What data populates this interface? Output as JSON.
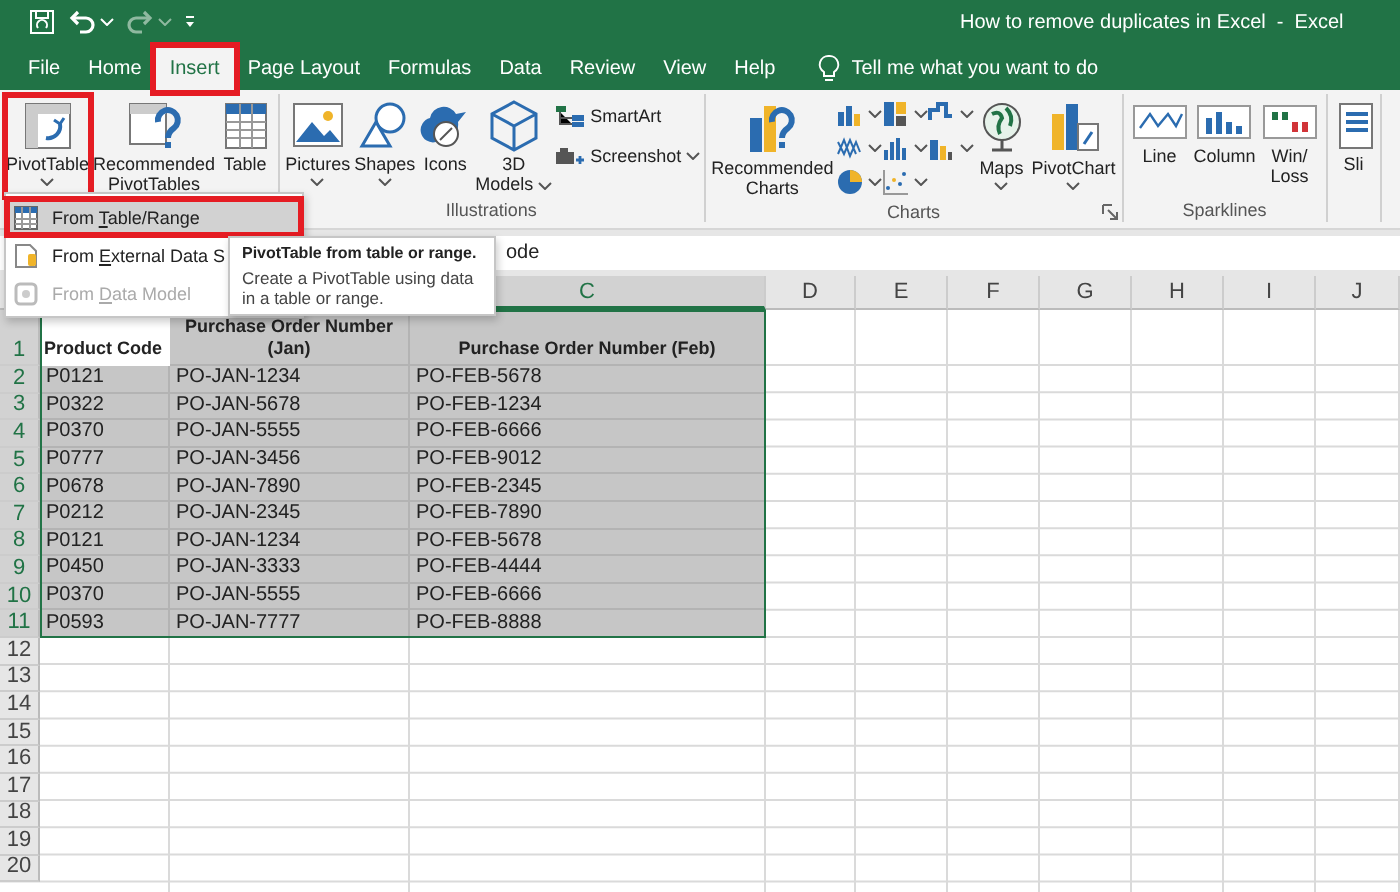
{
  "window": {
    "title": "How to remove duplicates in Excel  -  Excel"
  },
  "tabs": [
    {
      "label": "File",
      "selected": false,
      "annotated": false
    },
    {
      "label": "Home",
      "selected": false,
      "annotated": false
    },
    {
      "label": "Insert",
      "selected": true,
      "annotated": true
    },
    {
      "label": "Page Layout",
      "selected": false,
      "annotated": false
    },
    {
      "label": "Formulas",
      "selected": false,
      "annotated": false
    },
    {
      "label": "Data",
      "selected": false,
      "annotated": false
    },
    {
      "label": "Review",
      "selected": false,
      "annotated": false
    },
    {
      "label": "View",
      "selected": false,
      "annotated": false
    },
    {
      "label": "Help",
      "selected": false,
      "annotated": false
    }
  ],
  "tell_me": {
    "placeholder": "Tell me what you want to do"
  },
  "ribbon": [
    {
      "items": [
        {
          "kind": "large",
          "label": "PivotTable",
          "dropdown": true,
          "annotated": true
        },
        {
          "kind": "large",
          "label": "Recommended\nPivotTables",
          "dropdown": false,
          "annotated": false
        },
        {
          "kind": "large",
          "label": "Table",
          "dropdown": false,
          "annotated": false
        }
      ]
    },
    {
      "label": "Illustrations",
      "items": [
        {
          "kind": "large",
          "label": "Pictures",
          "dropdown": true,
          "annotated": false
        },
        {
          "kind": "large",
          "label": "Shapes",
          "dropdown": true,
          "annotated": false
        },
        {
          "kind": "large",
          "label": "Icons",
          "dropdown": false,
          "annotated": false
        },
        {
          "kind": "large",
          "label": "3D\nModels",
          "dropdown": true,
          "annotated": false
        },
        {
          "kind": "small",
          "label": "SmartArt",
          "dropdown": false,
          "annotated": false
        },
        {
          "kind": "small",
          "label": "Screenshot",
          "dropdown": true,
          "annotated": false
        }
      ]
    },
    {
      "label": "Charts",
      "launcher": true,
      "items": [
        {
          "kind": "large",
          "label": "Recommended\nCharts",
          "dropdown": false,
          "annotated": false
        },
        {
          "kind": "gallery",
          "annotated": false
        },
        {
          "kind": "large",
          "label": "Maps",
          "dropdown": true,
          "annotated": false
        },
        {
          "kind": "large",
          "label": "PivotChart",
          "dropdown": true,
          "annotated": false
        }
      ]
    },
    {
      "label": "Sparklines",
      "items": [
        {
          "kind": "large",
          "label": "Line",
          "dropdown": false,
          "annotated": false
        },
        {
          "kind": "large",
          "label": "Column",
          "dropdown": false,
          "annotated": false
        },
        {
          "kind": "large",
          "label": "Win/\nLoss",
          "dropdown": false,
          "annotated": false
        }
      ]
    },
    {
      "items": [
        {
          "kind": "large",
          "label": "Sli",
          "dropdown": false,
          "annotated": false
        }
      ]
    }
  ],
  "formula_bar": {
    "value": "ode"
  },
  "dropdown_menu": [
    {
      "before": "From ",
      "key": "T",
      "after": "able/Range",
      "selected": true,
      "disabled": false,
      "annotated": true
    },
    {
      "before": "From ",
      "key": "E",
      "after": "xternal Data S",
      "selected": false,
      "disabled": false,
      "annotated": false
    },
    {
      "before": "From ",
      "key": "D",
      "after": "ata Model",
      "selected": false,
      "disabled": true,
      "annotated": false
    }
  ],
  "tooltip": {
    "title": "PivotTable from table or range.",
    "body": "Create a PivotTable using data in a table or range."
  },
  "sheet": {
    "column_headers": [
      "C",
      "D",
      "E",
      "F",
      "G",
      "H",
      "I",
      "J"
    ],
    "rows": [
      {
        "number": "1",
        "kind": "header",
        "selected": true,
        "active": true,
        "cells": [
          "Product Code",
          "Purchase Order Number (Jan)",
          "Purchase Order Number (Feb)"
        ]
      },
      {
        "number": "2",
        "kind": "data",
        "selected": true,
        "active": false,
        "cells": [
          "P0121",
          "PO-JAN-1234",
          "PO-FEB-5678"
        ]
      },
      {
        "number": "3",
        "kind": "data",
        "selected": true,
        "active": false,
        "cells": [
          "P0322",
          "PO-JAN-5678",
          "PO-FEB-1234"
        ]
      },
      {
        "number": "4",
        "kind": "data",
        "selected": true,
        "active": false,
        "cells": [
          "P0370",
          "PO-JAN-5555",
          "PO-FEB-6666"
        ]
      },
      {
        "number": "5",
        "kind": "data",
        "selected": true,
        "active": false,
        "cells": [
          "P0777",
          "PO-JAN-3456",
          "PO-FEB-9012"
        ]
      },
      {
        "number": "6",
        "kind": "data",
        "selected": true,
        "active": false,
        "cells": [
          "P0678",
          "PO-JAN-7890",
          "PO-FEB-2345"
        ]
      },
      {
        "number": "7",
        "kind": "data",
        "selected": true,
        "active": false,
        "cells": [
          "P0212",
          "PO-JAN-2345",
          "PO-FEB-7890"
        ]
      },
      {
        "number": "8",
        "kind": "data",
        "selected": true,
        "active": false,
        "cells": [
          "P0121",
          "PO-JAN-1234",
          "PO-FEB-5678"
        ]
      },
      {
        "number": "9",
        "kind": "data",
        "selected": true,
        "active": false,
        "cells": [
          "P0450",
          "PO-JAN-3333",
          "PO-FEB-4444"
        ]
      },
      {
        "number": "10",
        "kind": "data",
        "selected": true,
        "active": false,
        "cells": [
          "P0370",
          "PO-JAN-5555",
          "PO-FEB-6666"
        ]
      },
      {
        "number": "11",
        "kind": "data",
        "selected": true,
        "active": false,
        "cells": [
          "P0593",
          "PO-JAN-7777",
          "PO-FEB-8888"
        ]
      },
      {
        "number": "12",
        "kind": "data",
        "selected": false,
        "cells": []
      },
      {
        "number": "13",
        "kind": "data",
        "selected": false,
        "cells": []
      },
      {
        "number": "14",
        "kind": "data",
        "selected": false,
        "cells": []
      },
      {
        "number": "15",
        "kind": "data",
        "selected": false,
        "cells": []
      },
      {
        "number": "16",
        "kind": "data",
        "selected": false,
        "cells": []
      },
      {
        "number": "17",
        "kind": "data",
        "selected": false,
        "cells": []
      },
      {
        "number": "18",
        "kind": "data",
        "selected": false,
        "cells": []
      },
      {
        "number": "19",
        "kind": "data",
        "selected": false,
        "cells": []
      },
      {
        "number": "20",
        "kind": "data",
        "selected": false,
        "cells": []
      }
    ]
  }
}
